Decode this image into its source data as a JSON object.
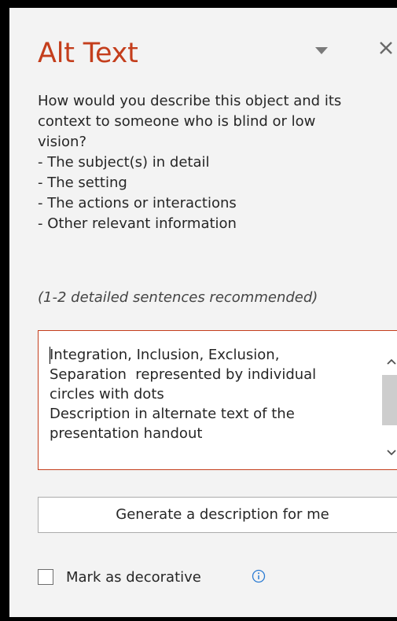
{
  "pane": {
    "title": "Alt Text",
    "dropdown_icon": "caret-down-icon",
    "close_icon": "close-icon",
    "accent_color": "#c43e1c"
  },
  "instructions": {
    "question_line1": "How would you describe this object and its",
    "question_line2": "context to someone who is blind or low",
    "question_line3": "vision?",
    "bullets": [
      "- The subject(s) in detail",
      "- The setting",
      "- The actions or interactions",
      "- Other relevant information"
    ],
    "hint": "(1-2 detailed sentences recommended)"
  },
  "description": {
    "value": "Integration, Inclusion, Exclusion,\nSeparation  represented by individual\ncircles with dots\nDescription in alternate text of the\npresentation handout"
  },
  "generate_button": {
    "label": "Generate a description for me"
  },
  "decorative": {
    "label": "Mark as decorative",
    "checked": false,
    "info_icon": "info-icon",
    "info_color": "#2b7cd3"
  }
}
